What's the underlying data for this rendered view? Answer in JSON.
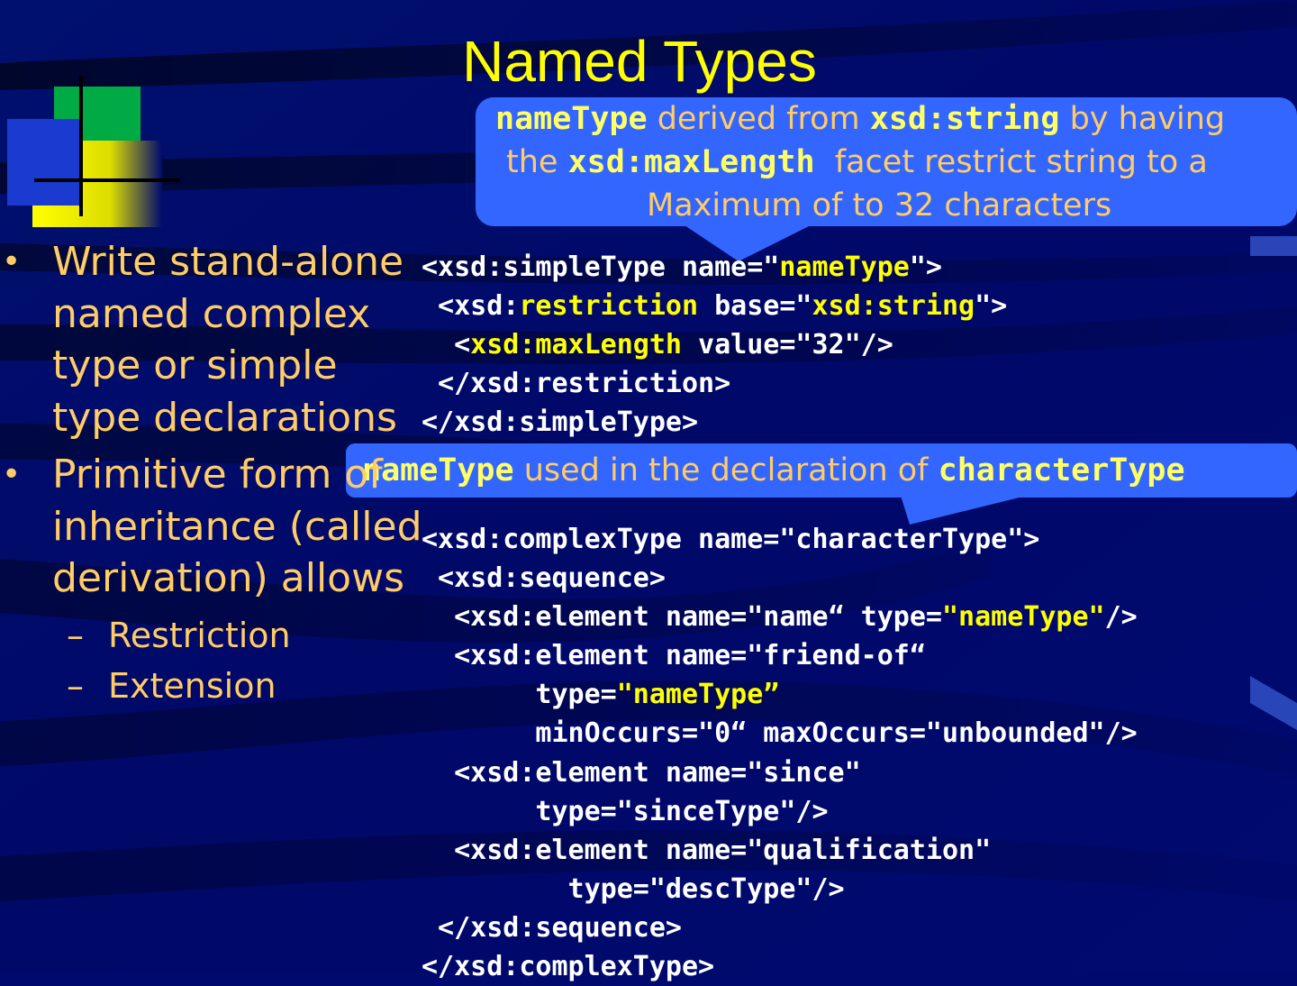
{
  "slide": {
    "title": "Named Types",
    "bullets": [
      {
        "text": "Write stand-alone named complex type or simple type declarations"
      },
      {
        "text": "Primitive form of inheritance (called derivation) allows"
      }
    ],
    "sub_bullets": [
      "Restriction",
      "Extension"
    ],
    "bullet_marker": "•",
    "dash_marker": "–"
  },
  "callout1": {
    "line1": {
      "t1": "nameType",
      "t2": " derived from ",
      "t3": "xsd:string",
      "t4": " by having"
    },
    "line2": {
      "t1": "the ",
      "t2": "xsd:maxLength",
      "t3": "  facet restrict string to a"
    },
    "line3": "Maximum of to 32 characters"
  },
  "callout2": {
    "t1": "nameType",
    "t2": " used in the declaration of ",
    "t3": "characterType"
  },
  "code1": {
    "l1a": "<xsd:simpleType name=\"",
    "l1b": "nameType",
    "l1c": "\">",
    "l2a": " <xsd:",
    "l2b": "restriction",
    "l2c": " base=\"",
    "l2d": "xsd:string",
    "l2e": "\">",
    "l3a": "  <",
    "l3b": "xsd:maxLength",
    "l3c": " value=\"32\"/>",
    "l4": " </xsd:restriction>",
    "l5": "</xsd:simpleType>"
  },
  "code2": {
    "l1": "<xsd:complexType name=\"characterType\">",
    "l2": " <xsd:sequence>",
    "l3a": "  <xsd:element name=\"name“ type=",
    "l3b": "\"nameType\"",
    "l3c": "/>",
    "l4": "  <xsd:element name=\"friend-of“",
    "l5a": "       type=",
    "l5b": "\"nameType”",
    "l6": "       minOccurs=\"0“ maxOccurs=\"unbounded\"/>",
    "l7": "  <xsd:element name=\"since\"",
    "l8": "       type=\"sinceType\"/>",
    "l9": "  <xsd:element name=\"qualification\"",
    "l10": "         type=\"descType\"/>",
    "l11": " </xsd:sequence>",
    "l12": "</xsd:complexType>"
  },
  "colors": {
    "background": "#000a6e",
    "title": "#ffff00",
    "body_text": "#ffcc66",
    "callout": "#3366ff",
    "code": "#ffffff",
    "code_highlight": "#ffff00"
  }
}
